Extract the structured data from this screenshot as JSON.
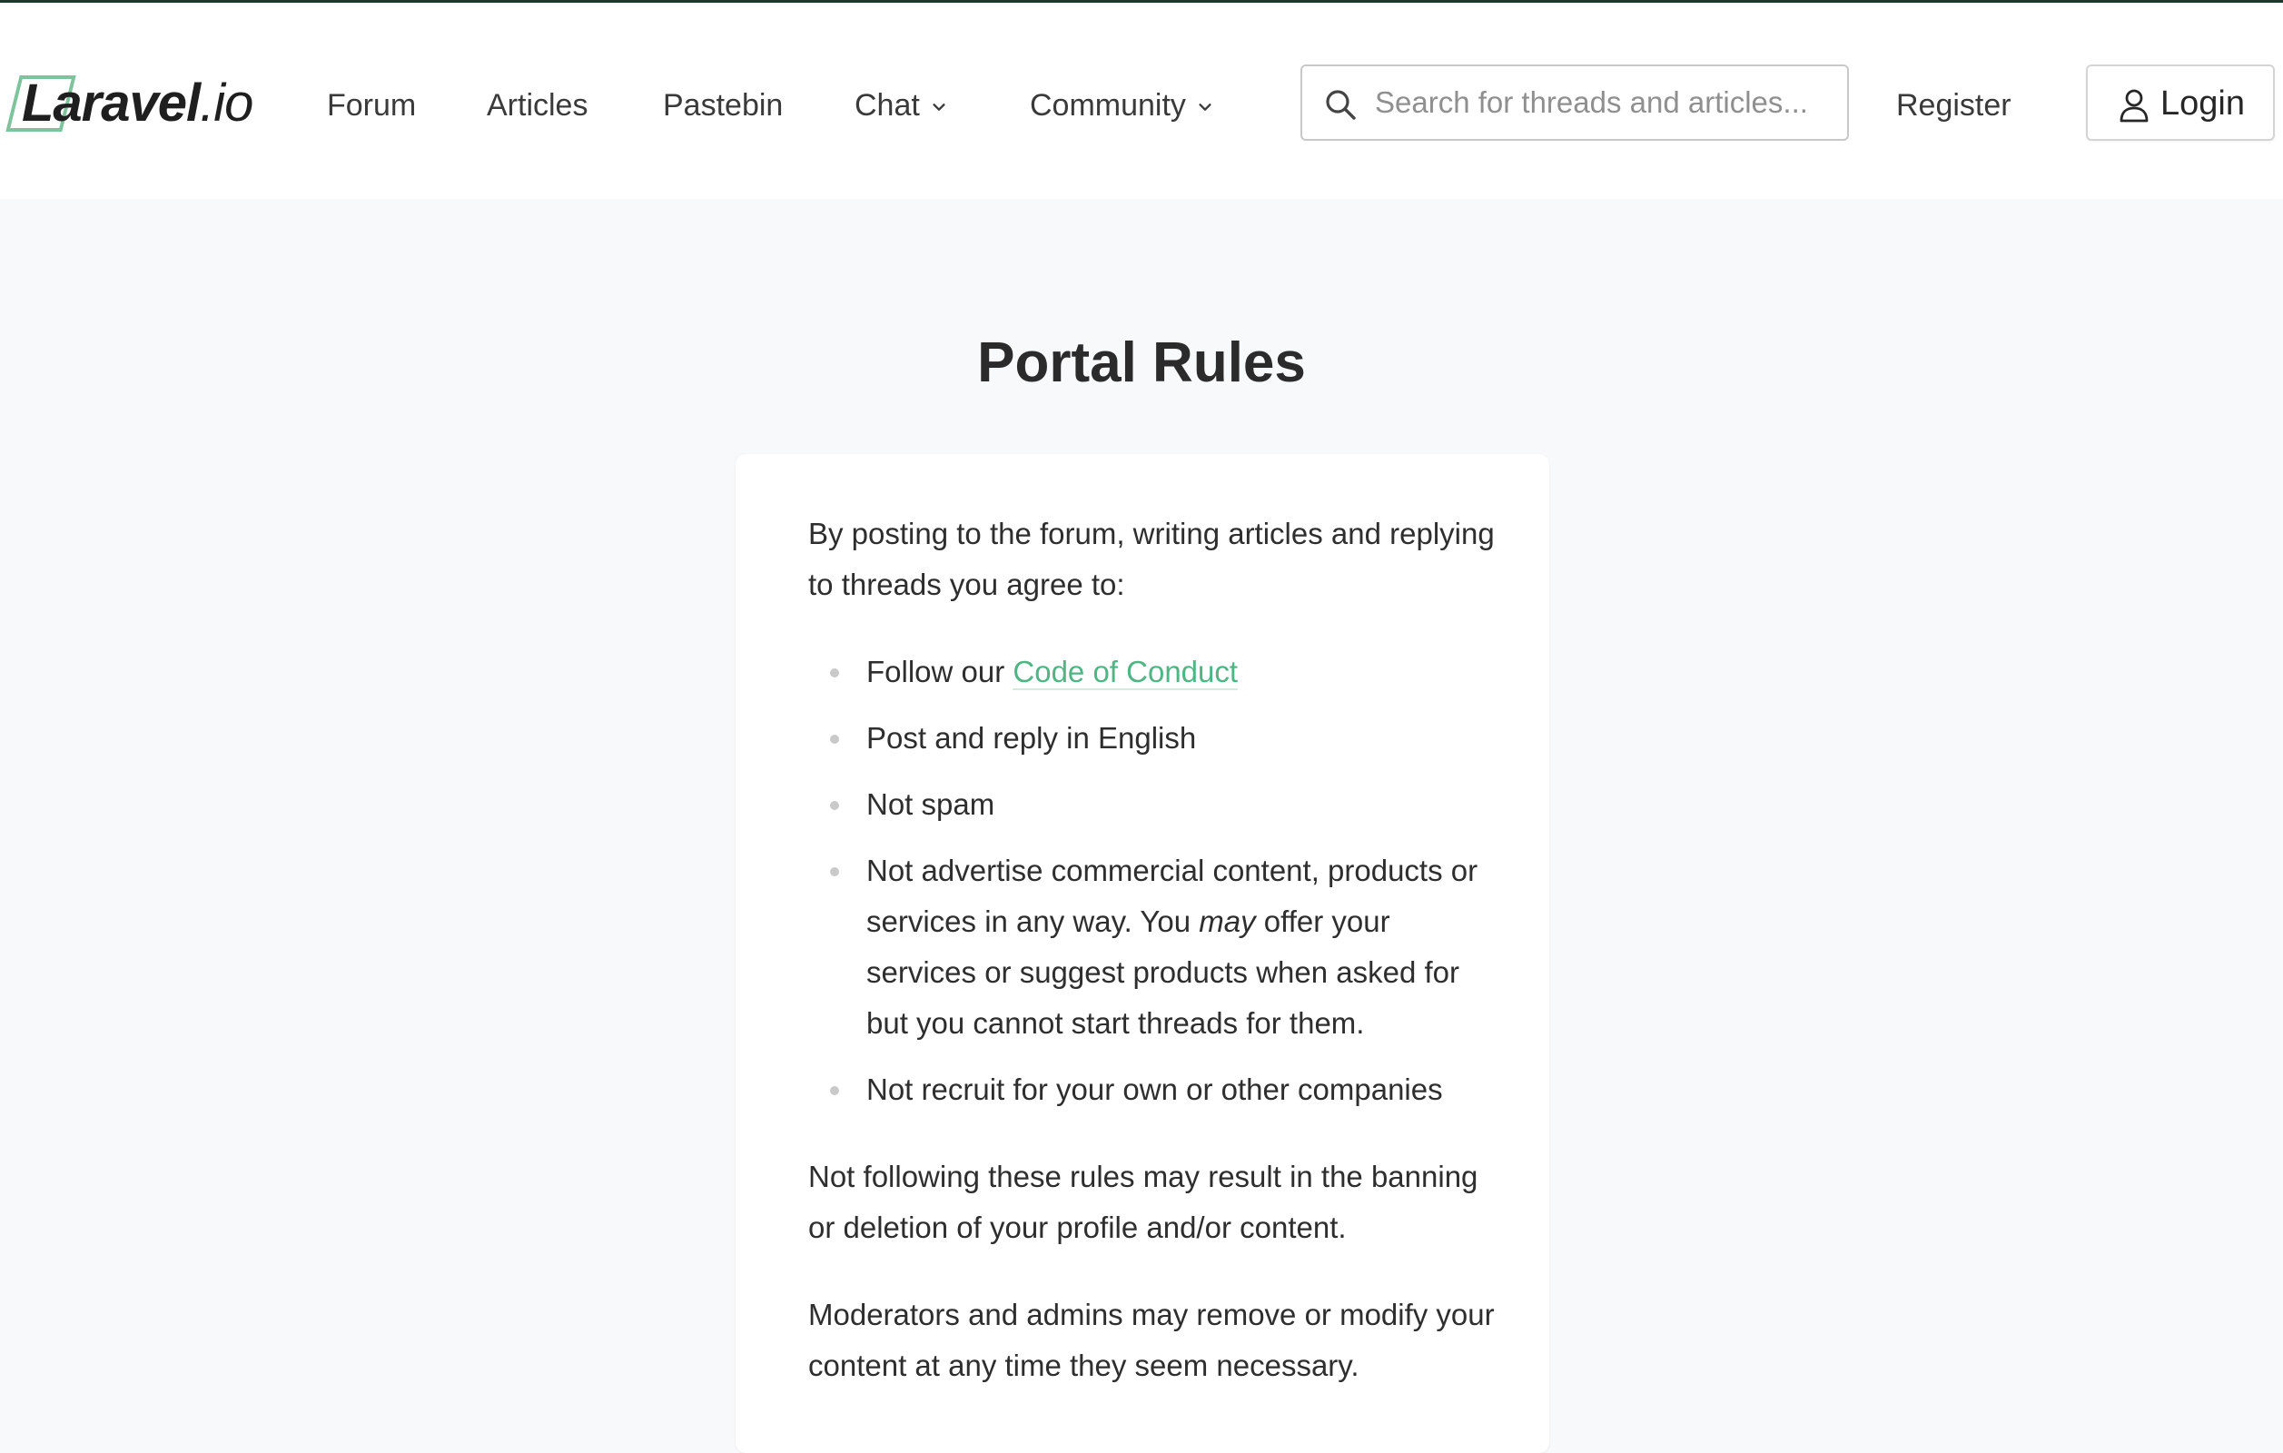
{
  "header": {
    "logo": {
      "word": "Laravel",
      "suffix": ".io"
    },
    "nav": {
      "forum": "Forum",
      "articles": "Articles",
      "pastebin": "Pastebin",
      "chat": "Chat",
      "community": "Community"
    },
    "search": {
      "placeholder": "Search for threads and articles..."
    },
    "register": "Register",
    "login": "Login"
  },
  "page": {
    "title": "Portal Rules",
    "intro": "By posting to the forum, writing articles and replying to threads you agree to:",
    "rules": {
      "r1_prefix": "Follow our ",
      "r1_link": "Code of Conduct",
      "r2": "Post and reply in English",
      "r3": "Not spam",
      "r4_before": "Not advertise commercial content, products or services in any way. You ",
      "r4_em": "may",
      "r4_after": " offer your services or suggest products when asked for but you cannot start threads for them.",
      "r5": "Not recruit for your own or other companies"
    },
    "consequence": "Not following these rules may result in the banning or deletion of your profile and/or content.",
    "moderation": "Moderators and admins may remove or modify your content at any time they seem necessary."
  },
  "colors": {
    "accent": "#4fb584",
    "logo_accent": "#7cc49b",
    "top_border": "#18392b",
    "background": "#f8f9fa"
  },
  "icons": {
    "search": "search-icon",
    "chevron": "chevron-down-icon",
    "user": "user-icon"
  }
}
